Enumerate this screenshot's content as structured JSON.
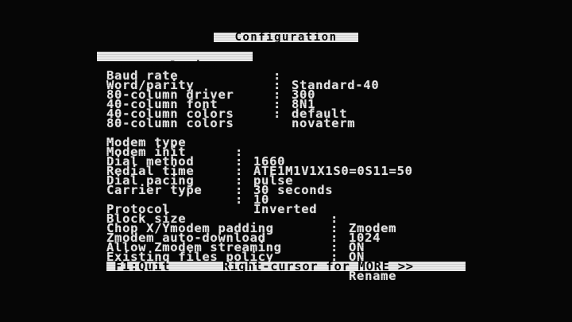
{
  "title": "Configuration",
  "section1": {
    "rows": [
      {
        "label": "Term emulation",
        "value": "Standard-40"
      },
      {
        "label": "Baud rate",
        "value": "300"
      },
      {
        "label": "Word/parity",
        "value": "8N1"
      },
      {
        "label": "80-column driver",
        "value": "default"
      },
      {
        "label": "40-column font",
        "value": "novaterm"
      },
      {
        "label": "40-column colors",
        "value": ""
      },
      {
        "label": "80-column colors",
        "value": ""
      }
    ]
  },
  "section2": {
    "rows": [
      {
        "label": "Modem type",
        "value": "1660"
      },
      {
        "label": "Modem init",
        "value": "ATE1M1V1X1S0=0S11=50"
      },
      {
        "label": "Dial method",
        "value": "pulse"
      },
      {
        "label": "Redial time",
        "value": "30 seconds"
      },
      {
        "label": "Dial pacing",
        "value": "10"
      },
      {
        "label": "Carrier type",
        "value": "Inverted"
      }
    ]
  },
  "section3": {
    "rows": [
      {
        "label": "Protocol",
        "value": "Zmodem"
      },
      {
        "label": "Block size",
        "value": "1024"
      },
      {
        "label": "Chop X/Ymodem padding",
        "value": "ON"
      },
      {
        "label": "Zmodem auto-download",
        "value": "ON"
      },
      {
        "label": "Allow Zmodem streaming",
        "value": "ON"
      },
      {
        "label": "Existing files policy",
        "value": "Rename"
      }
    ]
  },
  "separator": ":",
  "footer": {
    "quit": "F1:Quit",
    "more": "Right-cursor for MORE >>"
  },
  "colors": {
    "background": "#060606",
    "foreground": "#e9e9e9"
  }
}
